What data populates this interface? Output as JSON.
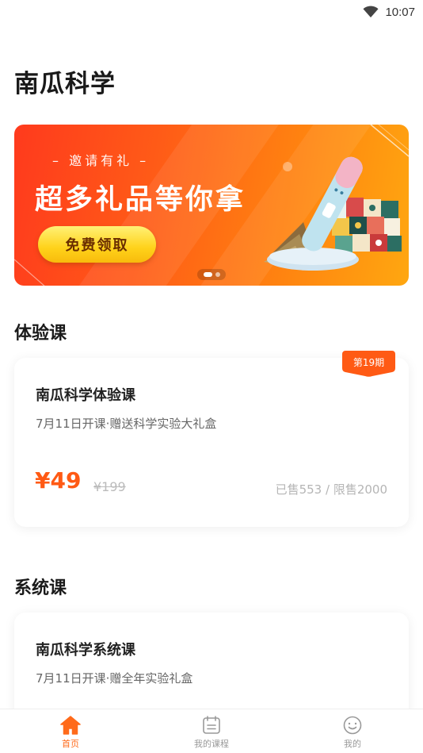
{
  "status_bar": {
    "time": "10:07",
    "wifi_icon": "wifi-icon"
  },
  "page": {
    "title": "南瓜科学"
  },
  "banner": {
    "subtitle": "– 邀请有礼 –",
    "title": "超多礼品等你拿",
    "button_label": "免费领取",
    "carousel": {
      "count": 2,
      "active_index": 0
    }
  },
  "trial_section": {
    "title": "体验课",
    "course": {
      "badge": "第19期",
      "name": "南瓜科学体验课",
      "description": "7月11日开课·赠送科学实验大礼盒",
      "price": "¥49",
      "original_price": "¥199",
      "sales": "已售553 / 限售2000"
    }
  },
  "system_section": {
    "title": "系统课",
    "course": {
      "name": "南瓜科学系统课",
      "description": "7月11日开课·赠全年实验礼盒"
    }
  },
  "tab_bar": {
    "active": "home",
    "accent_color": "#ff6a1a",
    "items": [
      {
        "key": "home",
        "label": "首页",
        "icon": "home-icon"
      },
      {
        "key": "courses",
        "label": "我的课程",
        "icon": "calendar-icon"
      },
      {
        "key": "me",
        "label": "我的",
        "icon": "smile-icon"
      }
    ]
  }
}
